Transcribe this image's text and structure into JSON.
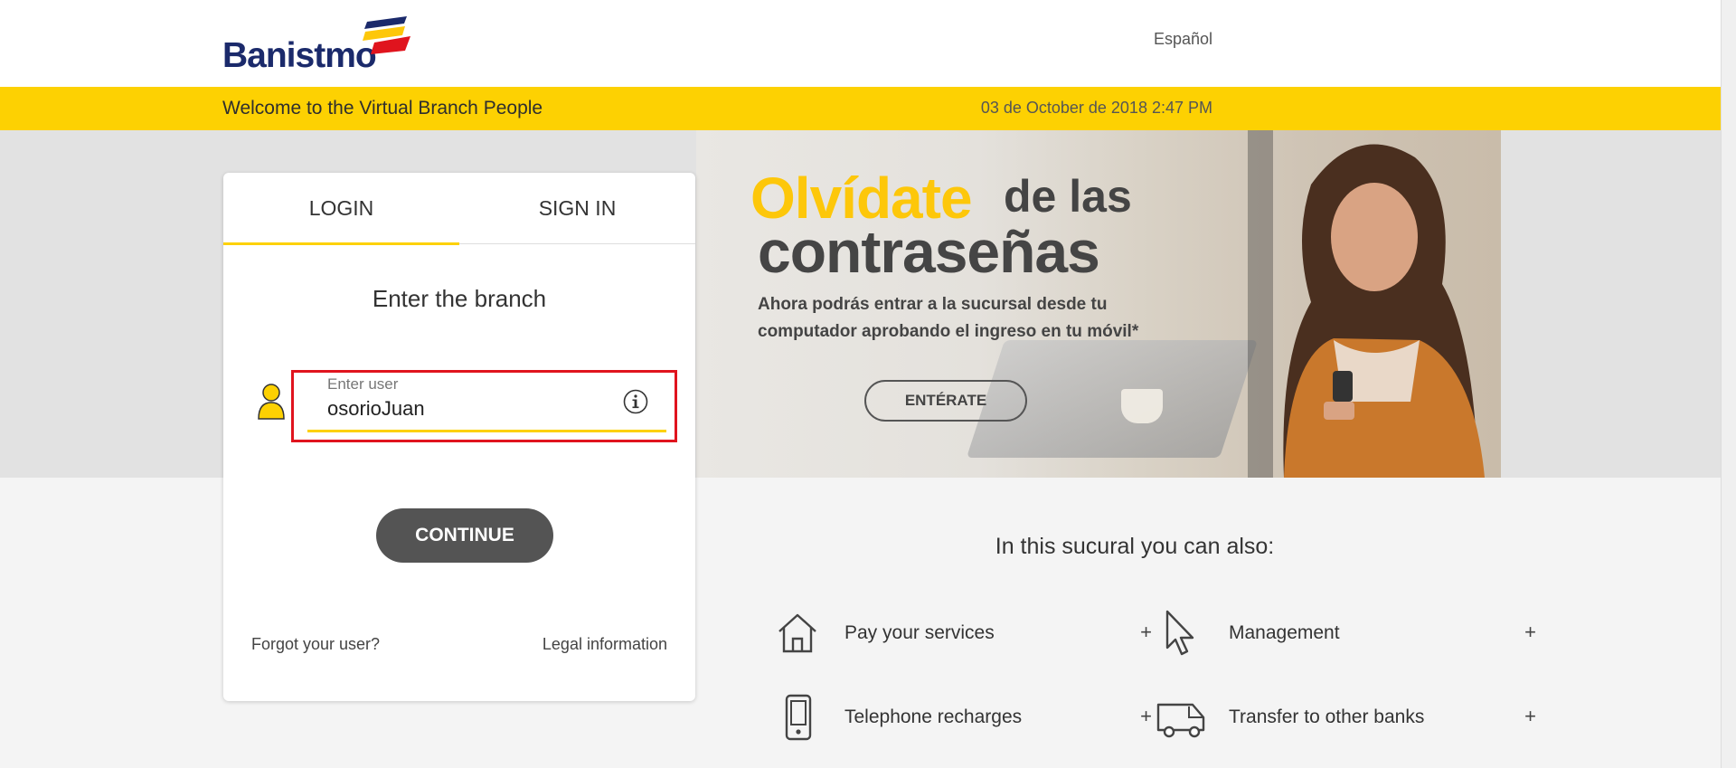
{
  "header": {
    "brand": "Banistmo",
    "language": "Español",
    "welcome": "Welcome to the Virtual Branch People",
    "datetime": "03 de October de 2018 2:47 PM"
  },
  "banner": {
    "headline_highlight": "Olvídate",
    "headline_rest": "de las",
    "headline_line2": "contraseñas",
    "body": "Ahora podrás entrar a la sucursal desde tu computador aprobando el ingreso en tu móvil*",
    "button": "ENTÉRATE"
  },
  "login_card": {
    "tabs": [
      {
        "label": "LOGIN",
        "active": true
      },
      {
        "label": "SIGN IN",
        "active": false
      }
    ],
    "title": "Enter the branch",
    "user_field": {
      "label": "Enter user",
      "value": "osorioJuan"
    },
    "continue_label": "CONTINUE",
    "forgot_label": "Forgot your user?",
    "legal_label": "Legal information"
  },
  "features": {
    "title": "In this sucural you can also:",
    "items": [
      {
        "label": "Pay your services",
        "icon": "house-icon",
        "plus": "+"
      },
      {
        "label": "Management",
        "icon": "cursor-icon",
        "plus": "+"
      },
      {
        "label": "Telephone recharges",
        "icon": "phone-icon",
        "plus": "+"
      },
      {
        "label": "Transfer to other banks",
        "icon": "truck-icon",
        "plus": "+"
      }
    ]
  },
  "colors": {
    "brand_yellow": "#fdd102",
    "brand_blue": "#1b2a6b",
    "button_gray": "#545454",
    "highlight_red": "#e0141e"
  }
}
